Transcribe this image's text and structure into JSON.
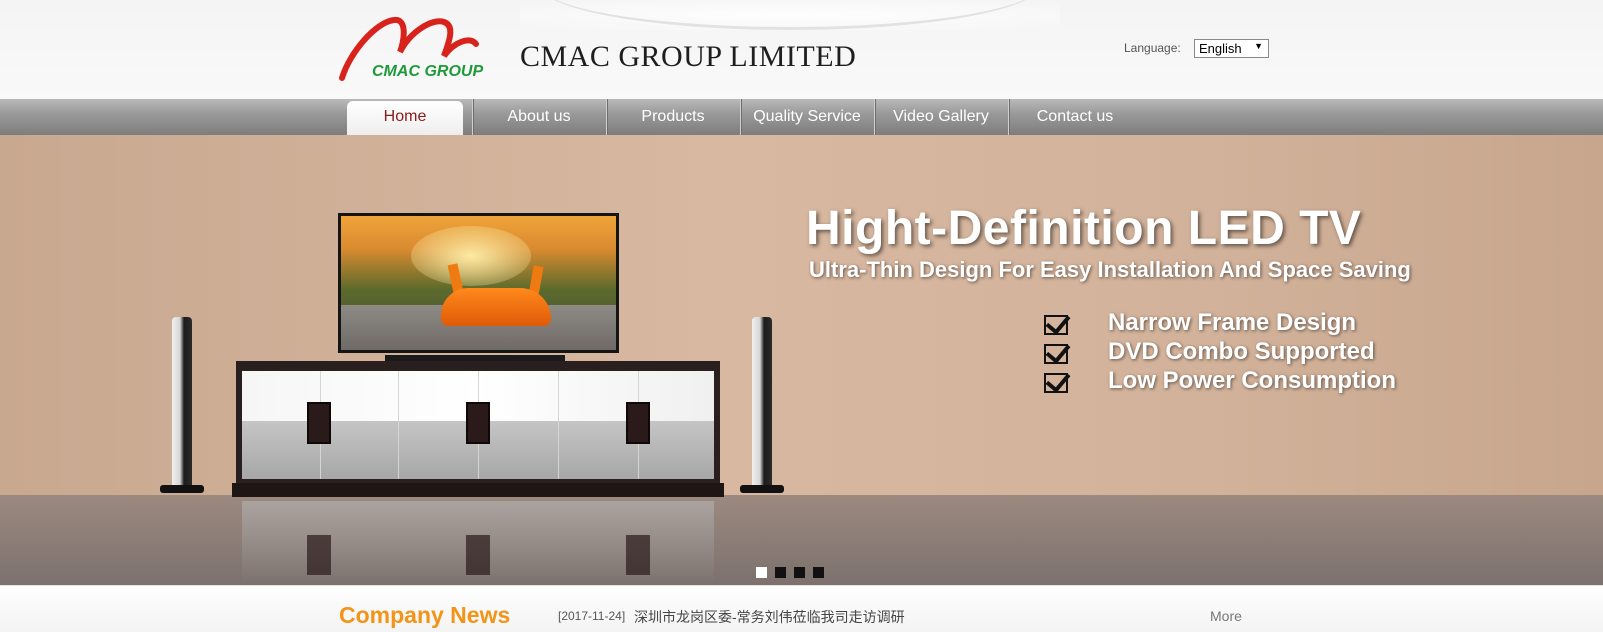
{
  "header": {
    "logo_text": "CMAC GROUP",
    "company_name": "CMAC GROUP LIMITED",
    "language_label": "Language:",
    "language_selected": "English"
  },
  "nav": {
    "items": [
      {
        "label": "Home",
        "active": true
      },
      {
        "label": "About us",
        "active": false
      },
      {
        "label": "Products",
        "active": false
      },
      {
        "label": "Quality Service",
        "active": false
      },
      {
        "label": "Video Gallery",
        "active": false
      },
      {
        "label": "Contact us",
        "active": false
      }
    ]
  },
  "banner": {
    "headline": "Hight-Definition LED TV",
    "subline": "Ultra-Thin Design For Easy Installation And Space Saving",
    "features": [
      "Narrow Frame Design",
      "DVD Combo Supported",
      "Low Power Consumption"
    ],
    "slide_count": 4,
    "active_slide": 1
  },
  "news": {
    "title": "Company News",
    "date": "[2017-11-24]",
    "headline": "深圳市龙岗区委-常务刘伟莅临我司走访调研",
    "more_label": "More"
  },
  "colors": {
    "accent_orange": "#f29418",
    "active_nav_text": "#8b1a1a",
    "logo_red": "#d8231c",
    "logo_green": "#1e9a3a"
  }
}
